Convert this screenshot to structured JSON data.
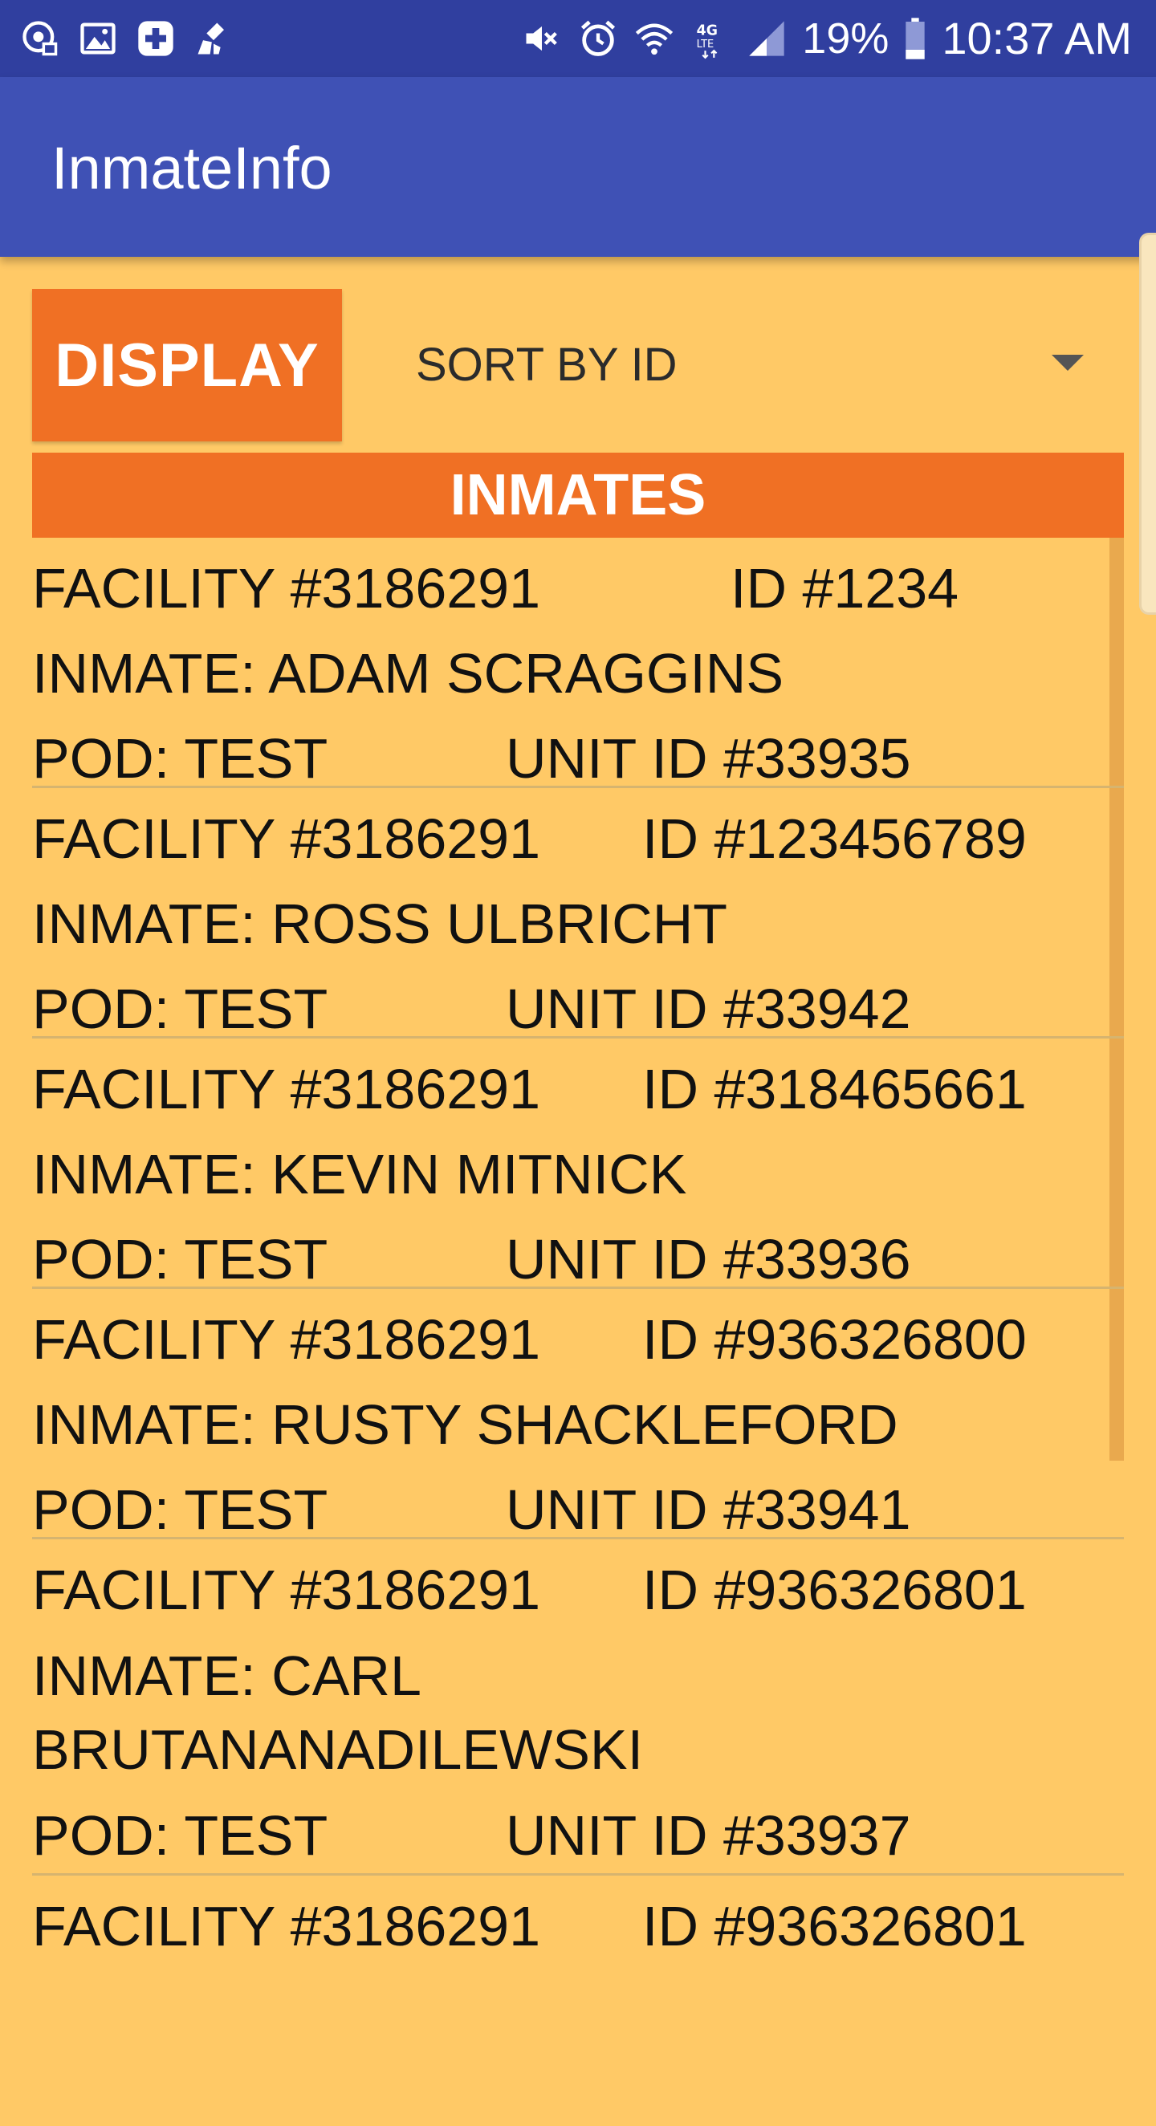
{
  "status_bar": {
    "left_icons": [
      "voicemail-icon",
      "gallery-icon",
      "medical-plus-icon",
      "cleaner-icon"
    ],
    "right_icons": [
      "mute-icon",
      "alarm-icon",
      "wifi-icon",
      "4g-lte-icon",
      "signal-icon",
      "battery-icon"
    ],
    "battery_percent": "19%",
    "time": "10:37 AM"
  },
  "app_bar": {
    "title": "InmateInfo"
  },
  "controls": {
    "display_button": "DISPLAY",
    "sort_selected": "SORT BY ID"
  },
  "list": {
    "header": "INMATES",
    "rows": [
      {
        "facility": "FACILITY #3186291",
        "id": "ID #1234",
        "inmate": "INMATE: ADAM SCRAGGINS",
        "pod": "POD: TEST",
        "unit": "UNIT ID #33935"
      },
      {
        "facility": "FACILITY #3186291",
        "id": "ID #123456789",
        "inmate": "INMATE: ROSS ULBRICHT",
        "pod": "POD: TEST",
        "unit": "UNIT ID #33942"
      },
      {
        "facility": "FACILITY #3186291",
        "id": "ID #318465661",
        "inmate": "INMATE: KEVIN MITNICK",
        "pod": "POD: TEST",
        "unit": "UNIT ID #33936"
      },
      {
        "facility": "FACILITY #3186291",
        "id": "ID #936326800",
        "inmate": "INMATE: RUSTY SHACKLEFORD",
        "pod": "POD: TEST",
        "unit": "UNIT ID #33941"
      },
      {
        "facility": "FACILITY #3186291",
        "id": "ID #936326801",
        "inmate": "INMATE: CARL BRUTANANADILEWSKI",
        "pod": "POD: TEST",
        "unit": "UNIT ID #33937"
      },
      {
        "facility": "FACILITY #3186291",
        "id": "ID #936326801"
      }
    ]
  },
  "colors": {
    "status_bar": "#303F9F",
    "app_bar": "#3F51B5",
    "background": "#FFC966",
    "accent": "#F07024"
  }
}
